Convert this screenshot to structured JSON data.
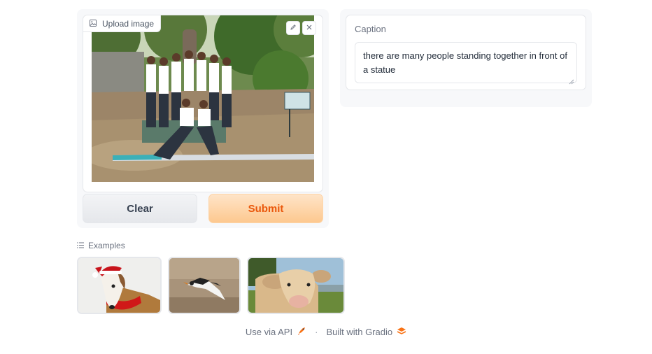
{
  "input": {
    "label": "Upload image",
    "image_alt": "group of people standing together in front of a statue",
    "edit_icon": "pencil-icon",
    "clear_icon": "close-icon"
  },
  "buttons": {
    "clear": "Clear",
    "submit": "Submit"
  },
  "output": {
    "label": "Caption",
    "value": "there are many people standing together in front of a statue"
  },
  "examples": {
    "label": "Examples",
    "items": [
      {
        "name": "dog-with-santa-hat"
      },
      {
        "name": "bird-in-flight"
      },
      {
        "name": "cow-in-field"
      }
    ]
  },
  "footer": {
    "api": "Use via API",
    "separator": "·",
    "built": "Built with Gradio"
  },
  "colors": {
    "accent": "#ea580c",
    "submit_bg": "#fdc88f"
  }
}
